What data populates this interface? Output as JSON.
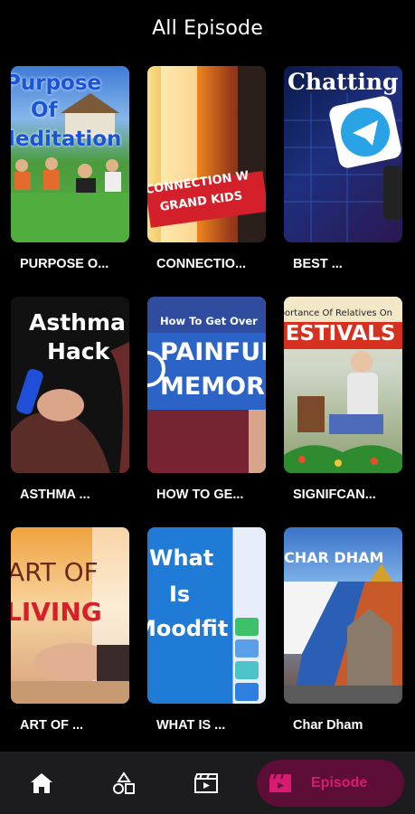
{
  "header": {
    "title": "All Episode"
  },
  "episodes": [
    {
      "label": "PURPOSE O...",
      "thumb_text": [
        "Purpose",
        "Of",
        "Meditation"
      ]
    },
    {
      "label": "CONNECTIO...",
      "thumb_text": [
        "CONNECTION W",
        "GRAND KIDS"
      ]
    },
    {
      "label": "BEST ...",
      "thumb_text": [
        "Chatting"
      ]
    },
    {
      "label": "ASTHMA ...",
      "thumb_text": [
        "Asthma",
        "Hack"
      ]
    },
    {
      "label": "HOW TO GE...",
      "thumb_text": [
        "How To Get Over",
        "PAINFUL",
        "MEMORIES"
      ]
    },
    {
      "label": "SIGNIFCAN...",
      "thumb_text": [
        "Importance Of Relatives On",
        "FESTIVALS"
      ]
    },
    {
      "label": "ART OF ...",
      "thumb_text": [
        "ART OF",
        "LIVING"
      ]
    },
    {
      "label": "WHAT IS ...",
      "thumb_text": [
        "What",
        "Is",
        "Moodfit"
      ]
    },
    {
      "label": "Char Dham",
      "thumb_text": [
        "CHAR DHAM"
      ]
    }
  ],
  "nav": {
    "items": [
      {
        "name": "home-icon"
      },
      {
        "name": "categories-icon"
      },
      {
        "name": "video-icon"
      }
    ],
    "active_label": "Episode"
  },
  "colors": {
    "background": "#000000",
    "nav_background": "#1c1c1e",
    "accent": "#d81b72",
    "accent_pill": "#5c0e37"
  }
}
